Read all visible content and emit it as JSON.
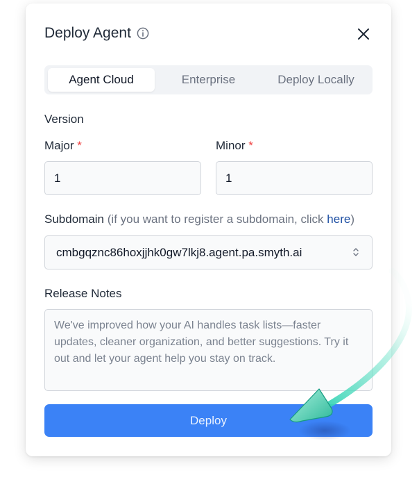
{
  "dialog": {
    "title": "Deploy Agent",
    "tabs": [
      {
        "label": "Agent Cloud",
        "active": true
      },
      {
        "label": "Enterprise",
        "active": false
      },
      {
        "label": "Deploy Locally",
        "active": false
      }
    ],
    "version": {
      "label": "Version",
      "major_label": "Major",
      "major_value": "1",
      "minor_label": "Minor",
      "minor_value": "1",
      "required_mark": "*"
    },
    "subdomain": {
      "label": "Subdomain",
      "hint_prefix": "(if you want to register a subdomain, click ",
      "hint_link": "here",
      "hint_suffix": ")",
      "value": "cmbgqznc86hoxjjhk0gw7lkj8.agent.pa.smyth.ai"
    },
    "release_notes": {
      "label": "Release Notes",
      "placeholder": "We've improved how your AI handles task lists—faster updates, cleaner organization, and better suggestions. Try it out and let your agent help you stay on track."
    },
    "deploy_label": "Deploy"
  },
  "colors": {
    "primary": "#3b82f6",
    "required": "#ef4444",
    "link": "#1e4fa3",
    "pointer_accent": "#34d3b4"
  },
  "icons": {
    "info": "info-circle-icon",
    "close": "close-icon",
    "select": "chevron-up-down-icon",
    "pointer": "cursor-arrow-icon"
  }
}
